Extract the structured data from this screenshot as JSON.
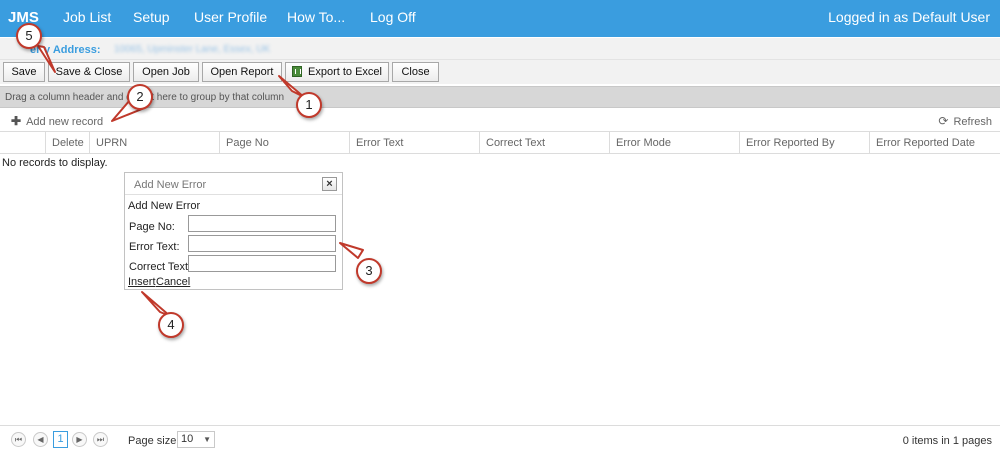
{
  "nav": {
    "brand": "JMS",
    "items": [
      "Job List",
      "Setup",
      "User Profile",
      "How To...",
      "Log Off"
    ],
    "user_status": "Logged in as Default User"
  },
  "property": {
    "label": "erty Address:",
    "value": "10065, Upminster Lane, Essex, UK"
  },
  "toolbar": {
    "buttons": [
      "Save",
      "Save & Close",
      "Open Job",
      "Open Report",
      "Export to Excel",
      "Close"
    ]
  },
  "grid": {
    "group_hint": "Drag a column header and drop it here to group by that column",
    "add_record": "Add new record",
    "refresh": "Refresh",
    "columns": [
      "Delete",
      "UPRN",
      "Page No",
      "Error Text",
      "Correct Text",
      "Error Mode",
      "Error Reported By",
      "Error Reported Date"
    ],
    "empty_text": "No records to display."
  },
  "popup": {
    "title": "Add New Error",
    "close_symbol": "×",
    "subtitle": "Add New Error",
    "fields": [
      {
        "label": "Page No:",
        "value": ""
      },
      {
        "label": "Error Text:",
        "value": ""
      },
      {
        "label": "Correct Text:",
        "value": ""
      }
    ],
    "insert": "Insert",
    "cancel": "Cancel"
  },
  "pager": {
    "current_page": "1",
    "page_size_label": "Page size:",
    "page_size": "10",
    "info": "0 items in 1 pages"
  },
  "callouts": [
    "1",
    "2",
    "3",
    "4",
    "5"
  ],
  "colors": {
    "nav_bg": "#3a9ddf",
    "callout_border": "#c0392b"
  }
}
